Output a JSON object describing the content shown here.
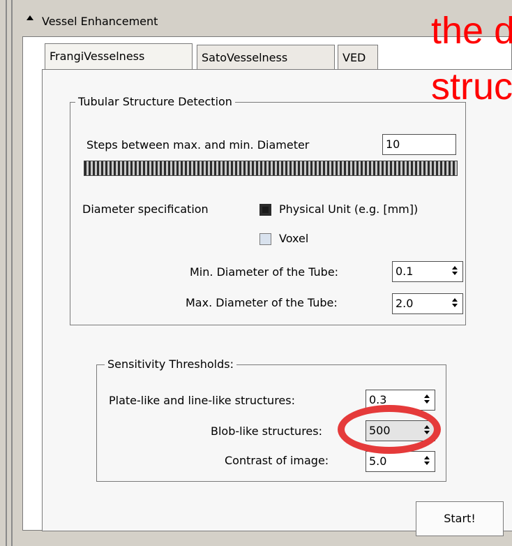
{
  "panel": {
    "title": "Vessel Enhancement"
  },
  "tabs": [
    {
      "label": "FrangiVesselness",
      "active": true
    },
    {
      "label": "SatoVesselness",
      "active": false
    },
    {
      "label": "VED",
      "active": false
    }
  ],
  "tubular": {
    "title": "Tubular Structure Detection",
    "steps_label": "Steps between max. and min. Diameter",
    "steps_value": "10",
    "diameter_spec_label": "Diameter specification",
    "option_physical": "Physical Unit (e.g. [mm])",
    "option_voxel": "Voxel",
    "min_label": "Min. Diameter of the Tube:",
    "min_value": "0.1",
    "max_label": "Max. Diameter of the Tube:",
    "max_value": "2.0"
  },
  "sensitivity": {
    "title": "Sensitivity Thresholds:",
    "plate_label": "Plate-like and line-like structures:",
    "plate_value": "0.3",
    "blob_label": "Blob-like structures:",
    "blob_value": "500",
    "contrast_label": "Contrast of image:",
    "contrast_value": "5.0"
  },
  "start_button": "Start!",
  "overlay": {
    "line1": "the d",
    "line2": "struc"
  },
  "colors": {
    "overlay_red": "#ff0000",
    "annotation_ellipse": "#e53a3a"
  },
  "icons": {
    "collapse": "triangle-up-icon",
    "spinner": "spinner-arrows-icon"
  }
}
